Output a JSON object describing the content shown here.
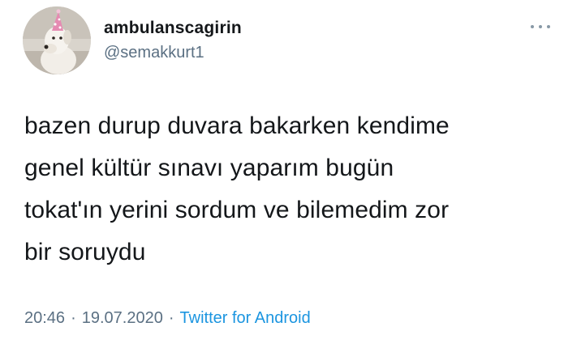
{
  "tweet": {
    "display_name": "ambulanscagirin",
    "handle": "@semakkurt1",
    "more_icon": "more-dots-icon",
    "text": "bazen durup duvara bakarken kendime\ngenel kültür sınavı yaparım bugün\ntokat'ın yerini sordum ve bilemedim zor\nbir soruydu",
    "time": "20:46",
    "separator": "·",
    "date": "19.07.2020",
    "source": "Twitter for Android"
  },
  "colors": {
    "text": "#14171a",
    "secondary": "#5b7083",
    "link": "#1b95e0"
  }
}
